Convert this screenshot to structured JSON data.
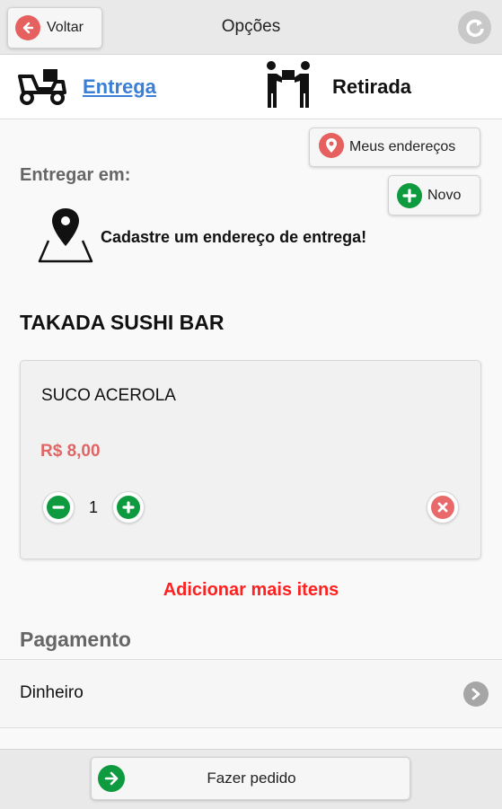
{
  "header": {
    "back_label": "Voltar",
    "title": "Opções",
    "refresh_icon": "refresh-icon"
  },
  "delivery_tabs": {
    "delivery": {
      "label": "Entrega",
      "icon": "delivery-scooter-icon",
      "active": true
    },
    "pickup": {
      "label": "Retirada",
      "icon": "handover-icon",
      "active": false
    }
  },
  "address": {
    "deliver_to_label": "Entregar em:",
    "my_addresses_label": "Meus endereços",
    "new_label": "Novo",
    "empty_message": "Cadastre um endereço de entrega!"
  },
  "store": {
    "name": "TAKADA SUSHI BAR"
  },
  "cart": {
    "items": [
      {
        "name": "SUCO ACEROLA",
        "price": "R$ 8,00",
        "quantity": "1"
      }
    ],
    "add_more_label": "Adicionar mais itens"
  },
  "payment": {
    "title": "Pagamento",
    "method": "Dinheiro"
  },
  "footer": {
    "order_label": "Fazer pedido"
  },
  "colors": {
    "green": "#0e9a3e",
    "red": "#e66060",
    "link_blue": "#3b7ed6",
    "alert_red": "#ff2020"
  }
}
